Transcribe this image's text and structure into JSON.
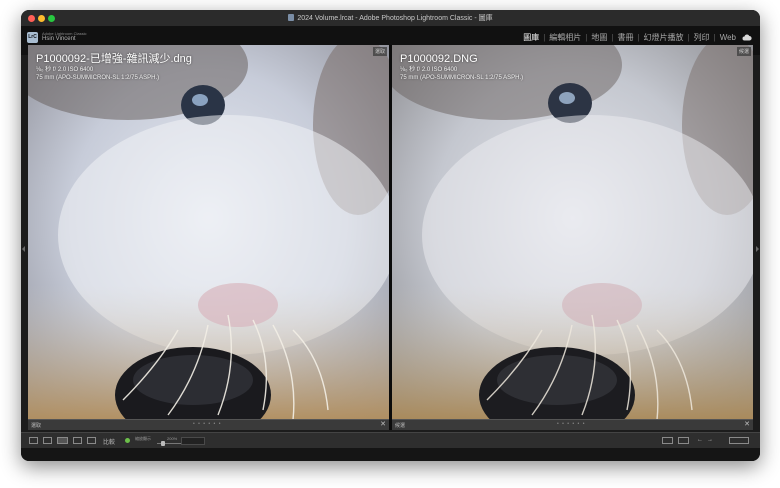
{
  "window": {
    "title": "2024 Volume.lrcat - Adobe Photoshop Lightroom Classic - 圖庫"
  },
  "identity": {
    "logo_text": "LrC",
    "app_name": "Adobe Lightroom Classic",
    "user_name": "Hsin Vincent"
  },
  "modules": {
    "items": [
      {
        "label": "圖庫",
        "active": true
      },
      {
        "label": "編輯相片",
        "active": false
      },
      {
        "label": "地圖",
        "active": false
      },
      {
        "label": "書冊",
        "active": false
      },
      {
        "label": "幻燈片播放",
        "active": false
      },
      {
        "label": "列印",
        "active": false
      },
      {
        "label": "Web",
        "active": false
      }
    ],
    "cloud_icon": "cloud-icon"
  },
  "left_panel": {
    "label": "選取",
    "filename": "P1000092-已增強-雜訊減少.dng",
    "exif_line1": "⅛₀ 秒 f/ 2.0 ISO 6400",
    "exif_line2": "75 mm (APO-SUMMICRON-SL 1:2/75 ASPH.)",
    "footer_label": "選取",
    "footer_dots": "• • • • • •"
  },
  "right_panel": {
    "label": "候選",
    "filename": "P1000092.DNG",
    "exif_line1": "⅛₀ 秒 f/ 2.0 ISO 6400",
    "exif_line2": "75 mm (APO-SUMMICRON-SL 1:2/75 ASPH.)",
    "footer_label": "候選",
    "footer_dots": "• • • • • •"
  },
  "toolbar": {
    "compare_label": "比較",
    "zoom_label": "縮放顯示",
    "zoom_value": "200%",
    "view_icons": [
      "grid-view-icon",
      "loupe-view-icon",
      "compare-view-icon",
      "survey-view-icon",
      "people-view-icon"
    ]
  },
  "colors": {
    "active_module": "#ffffff",
    "inactive_module": "#a8a8a8",
    "app_bg": "#1c1c1c"
  }
}
